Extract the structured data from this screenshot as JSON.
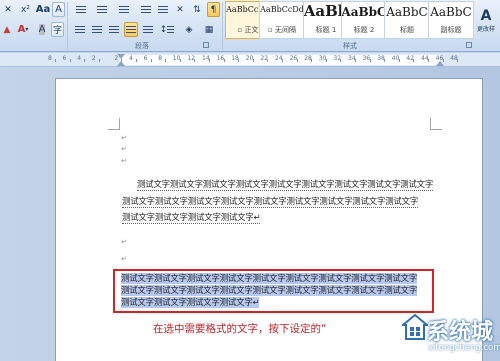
{
  "ribbon": {
    "paragraph_group_label": "段落",
    "styles_group_label": "样式",
    "change_styles_label": "更改样",
    "styles": [
      {
        "sample": "AaBbCcDd",
        "name": "▫ 正文",
        "selected": true
      },
      {
        "sample": "AaBbCcDd",
        "name": "▫ 无间隔",
        "selected": false
      },
      {
        "sample": "AaBb",
        "name": "标题 1",
        "selected": false
      },
      {
        "sample": "AaBbC",
        "name": "标题 2",
        "selected": false
      },
      {
        "sample": "AaBbC",
        "name": "标题",
        "selected": false
      },
      {
        "sample": "AaBbC",
        "name": "副标题",
        "selected": false
      }
    ]
  },
  "ruler": {
    "numbers": [
      "8",
      "6",
      "4",
      "2",
      "2",
      "4",
      "6",
      "8",
      "10",
      "12",
      "14",
      "16",
      "18",
      "20",
      "22",
      "24",
      "26",
      "28",
      "30",
      "32",
      "34",
      "36",
      "38",
      "40",
      "42",
      "44",
      "46",
      "48"
    ]
  },
  "document": {
    "para_mark": "↵",
    "lines_normal": [
      "测试文字测试文字测试文字测试文字测试文字测试文字测试文字测试文字测试文字",
      "测试文字测试文字测试文字测试文字测试文字测试文字测试文字测试文字测试文字",
      "测试文字测试文字测试文字测试文字↵"
    ],
    "lines_selected": [
      "测试文字测试文字测试文字测试文字测试文字测试文字测试文字测试文字测试文字",
      "测试文字测试文字测试文字测试文字测试文字测试文字测试文字测试文字测试文字",
      "测试文字测试文字测试文字测试文字↵"
    ],
    "annotation": "在选中需要格式的文字，按下设定的“"
  },
  "watermark": {
    "logo_text": "系统城",
    "url": "xitongcheng.com"
  }
}
